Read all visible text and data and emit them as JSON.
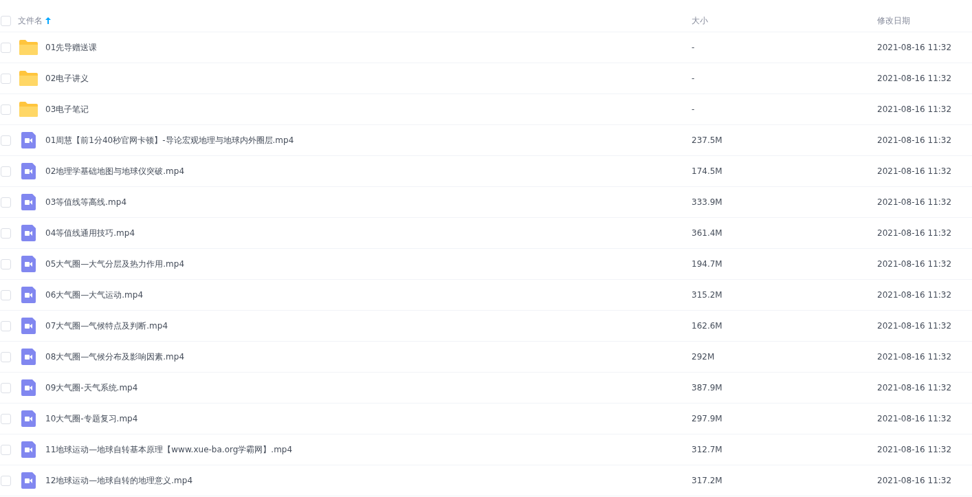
{
  "table": {
    "select_all": {
      "checked": false
    },
    "columns": [
      {
        "label": "文件名",
        "sorted": true
      },
      {
        "label": "大小",
        "sorted": false
      },
      {
        "label": "修改日期",
        "sorted": false
      }
    ],
    "rows": [
      {
        "kind": "folder",
        "name": "01先导赠送课",
        "size": "-",
        "date": "2021-08-16 11:32",
        "checked": false
      },
      {
        "kind": "folder",
        "name": "02电子讲义",
        "size": "-",
        "date": "2021-08-16 11:32",
        "checked": false
      },
      {
        "kind": "folder",
        "name": "03电子笔记",
        "size": "-",
        "date": "2021-08-16 11:32",
        "checked": false
      },
      {
        "kind": "video",
        "name": "01周慧【前1分40秒官网卡顿】-导论宏观地理与地球内外圈层.mp4",
        "size": "237.5M",
        "date": "2021-08-16 11:32",
        "checked": false
      },
      {
        "kind": "video",
        "name": "02地理学基础地图与地球仪突破.mp4",
        "size": "174.5M",
        "date": "2021-08-16 11:32",
        "checked": false
      },
      {
        "kind": "video",
        "name": "03等值线等高线.mp4",
        "size": "333.9M",
        "date": "2021-08-16 11:32",
        "checked": false
      },
      {
        "kind": "video",
        "name": "04等值线通用技巧.mp4",
        "size": "361.4M",
        "date": "2021-08-16 11:32",
        "checked": false
      },
      {
        "kind": "video",
        "name": "05大气圈—大气分层及热力作用.mp4",
        "size": "194.7M",
        "date": "2021-08-16 11:32",
        "checked": false
      },
      {
        "kind": "video",
        "name": "06大气圈—大气运动.mp4",
        "size": "315.2M",
        "date": "2021-08-16 11:32",
        "checked": false
      },
      {
        "kind": "video",
        "name": "07大气圈—气候特点及判断.mp4",
        "size": "162.6M",
        "date": "2021-08-16 11:32",
        "checked": false
      },
      {
        "kind": "video",
        "name": "08大气圈—气候分布及影响因素.mp4",
        "size": "292M",
        "date": "2021-08-16 11:32",
        "checked": false
      },
      {
        "kind": "video",
        "name": "09大气圈-天气系统.mp4",
        "size": "387.9M",
        "date": "2021-08-16 11:32",
        "checked": false
      },
      {
        "kind": "video",
        "name": "10大气圈-专题复习.mp4",
        "size": "297.9M",
        "date": "2021-08-16 11:32",
        "checked": false
      },
      {
        "kind": "video",
        "name": "11地球运动—地球自转基本原理【www.xue-ba.org学霸网】.mp4",
        "size": "312.7M",
        "date": "2021-08-16 11:32",
        "checked": false
      },
      {
        "kind": "video",
        "name": "12地球运动—地球自转的地理意义.mp4",
        "size": "317.2M",
        "date": "2021-08-16 11:32",
        "checked": false
      }
    ]
  }
}
